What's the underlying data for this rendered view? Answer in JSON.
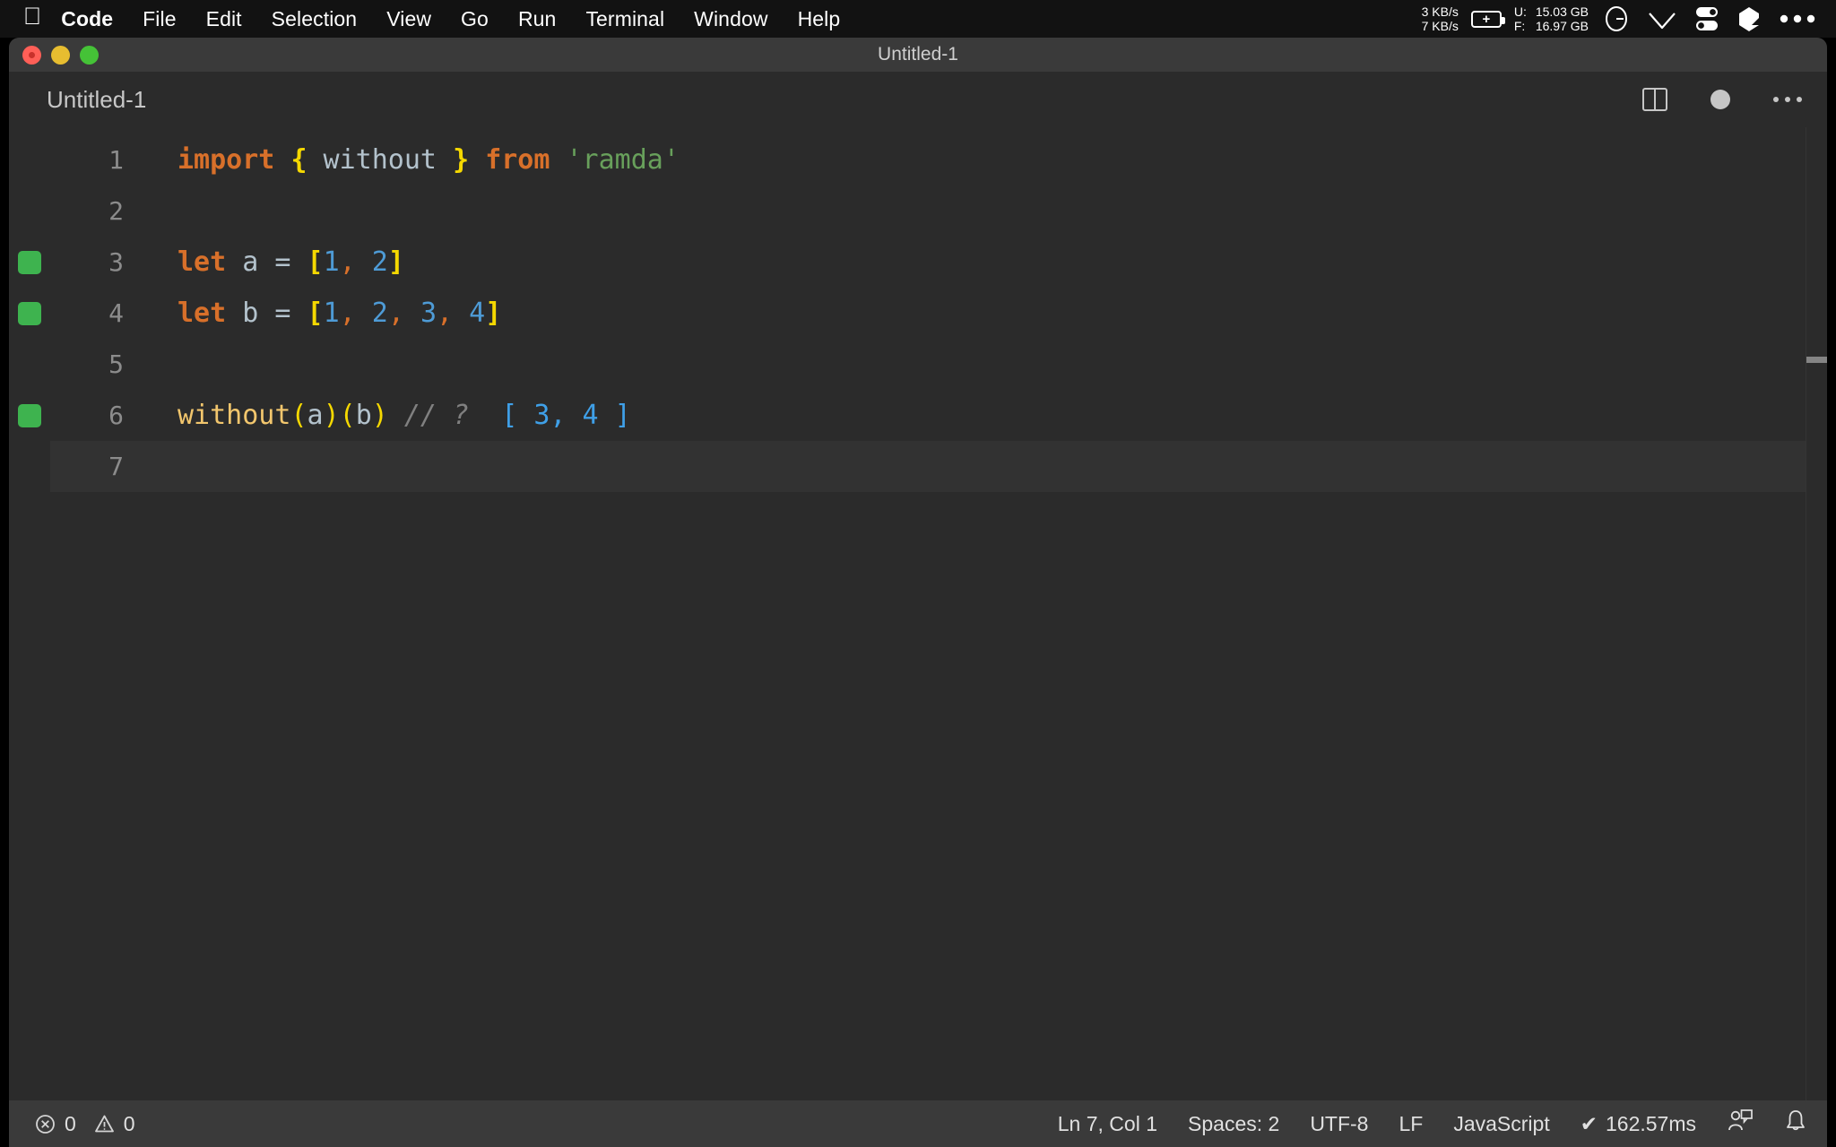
{
  "menubar": {
    "apple_icon": "apple-logo-icon",
    "items": [
      {
        "label": "Code",
        "bold": true
      },
      {
        "label": "File",
        "bold": false
      },
      {
        "label": "Edit",
        "bold": false
      },
      {
        "label": "Selection",
        "bold": false
      },
      {
        "label": "View",
        "bold": false
      },
      {
        "label": "Go",
        "bold": false
      },
      {
        "label": "Run",
        "bold": false
      },
      {
        "label": "Terminal",
        "bold": false
      },
      {
        "label": "Window",
        "bold": false
      },
      {
        "label": "Help",
        "bold": false
      }
    ],
    "network": {
      "upload": "3 KB/s",
      "download": "7 KB/s"
    },
    "battery_icon": "battery-charging-icon",
    "memory": {
      "used_key": "U:",
      "used_value": "15.03 GB",
      "free_key": "F:",
      "free_value": "16.97 GB"
    },
    "status_icons": [
      "clock-icon",
      "wifi-icon",
      "control-center-icon",
      "dropbox-icon",
      "more-menu-icon"
    ]
  },
  "window": {
    "title": "Untitled-1",
    "traffic_lights": [
      "close-button",
      "minimize-button",
      "maximize-button"
    ]
  },
  "tabbar": {
    "tab_label": "Untitled-1",
    "actions": [
      "split-editor-icon",
      "unsaved-dot-icon",
      "more-actions-icon"
    ]
  },
  "editor": {
    "language": "JavaScript",
    "lines": [
      {
        "number": "1",
        "decoration": false,
        "active": false,
        "tokens": [
          {
            "text": "import",
            "cls": "t-kw"
          },
          {
            "text": " ",
            "cls": "t-plain"
          },
          {
            "text": "{",
            "cls": "t-brace"
          },
          {
            "text": " without ",
            "cls": "t-plain"
          },
          {
            "text": "}",
            "cls": "t-brace"
          },
          {
            "text": " ",
            "cls": "t-plain"
          },
          {
            "text": "from",
            "cls": "t-kw"
          },
          {
            "text": " ",
            "cls": "t-plain"
          },
          {
            "text": "'ramda'",
            "cls": "t-str"
          }
        ]
      },
      {
        "number": "2",
        "decoration": false,
        "active": false,
        "tokens": []
      },
      {
        "number": "3",
        "decoration": true,
        "active": false,
        "tokens": [
          {
            "text": "let",
            "cls": "t-kw"
          },
          {
            "text": " a ",
            "cls": "t-plain"
          },
          {
            "text": "=",
            "cls": "t-op"
          },
          {
            "text": " ",
            "cls": "t-plain"
          },
          {
            "text": "[",
            "cls": "t-bracket"
          },
          {
            "text": "1",
            "cls": "t-num"
          },
          {
            "text": ",",
            "cls": "t-comma"
          },
          {
            "text": " ",
            "cls": "t-plain"
          },
          {
            "text": "2",
            "cls": "t-num"
          },
          {
            "text": "]",
            "cls": "t-bracket"
          }
        ]
      },
      {
        "number": "4",
        "decoration": true,
        "active": false,
        "tokens": [
          {
            "text": "let",
            "cls": "t-kw"
          },
          {
            "text": " b ",
            "cls": "t-plain"
          },
          {
            "text": "=",
            "cls": "t-op"
          },
          {
            "text": " ",
            "cls": "t-plain"
          },
          {
            "text": "[",
            "cls": "t-bracket"
          },
          {
            "text": "1",
            "cls": "t-num"
          },
          {
            "text": ",",
            "cls": "t-comma"
          },
          {
            "text": " ",
            "cls": "t-plain"
          },
          {
            "text": "2",
            "cls": "t-num"
          },
          {
            "text": ",",
            "cls": "t-comma"
          },
          {
            "text": " ",
            "cls": "t-plain"
          },
          {
            "text": "3",
            "cls": "t-num"
          },
          {
            "text": ",",
            "cls": "t-comma"
          },
          {
            "text": " ",
            "cls": "t-plain"
          },
          {
            "text": "4",
            "cls": "t-num"
          },
          {
            "text": "]",
            "cls": "t-bracket"
          }
        ]
      },
      {
        "number": "5",
        "decoration": false,
        "active": false,
        "tokens": []
      },
      {
        "number": "6",
        "decoration": true,
        "active": false,
        "tokens": [
          {
            "text": "without",
            "cls": "t-fn"
          },
          {
            "text": "(",
            "cls": "t-paren"
          },
          {
            "text": "a",
            "cls": "t-plain"
          },
          {
            "text": ")",
            "cls": "t-paren"
          },
          {
            "text": "(",
            "cls": "t-paren"
          },
          {
            "text": "b",
            "cls": "t-plain"
          },
          {
            "text": ")",
            "cls": "t-paren"
          },
          {
            "text": " ",
            "cls": "t-plain"
          },
          {
            "text": "// ?",
            "cls": "t-comment"
          },
          {
            "text": "  ",
            "cls": "t-plain"
          },
          {
            "text": "[ 3, 4 ]",
            "cls": "t-result"
          }
        ]
      },
      {
        "number": "7",
        "decoration": false,
        "active": true,
        "tokens": []
      }
    ]
  },
  "statusbar": {
    "errors_icon": "error-circle-icon",
    "errors": "0",
    "warnings_icon": "warning-triangle-icon",
    "warnings": "0",
    "cursor_position": "Ln 7, Col 1",
    "indentation": "Spaces: 2",
    "encoding": "UTF-8",
    "eol": "LF",
    "language": "JavaScript",
    "run_check": "✔",
    "run_time": "162.57ms",
    "feedback_icon": "feedback-person-icon",
    "notifications_icon": "bell-icon"
  },
  "colors": {
    "menubar_bg": "#121212",
    "titlebar_bg": "#3a3a3a",
    "editor_bg": "#2b2b2b",
    "statusbar_bg": "#3a3a3a",
    "decoration_green": "#3eb34f",
    "keyword_orange": "#d8702a",
    "bracket_yellow": "#f5d800",
    "string_green": "#68a05b",
    "number_blue": "#4e9bd6",
    "result_blue": "#3fa0e8"
  }
}
